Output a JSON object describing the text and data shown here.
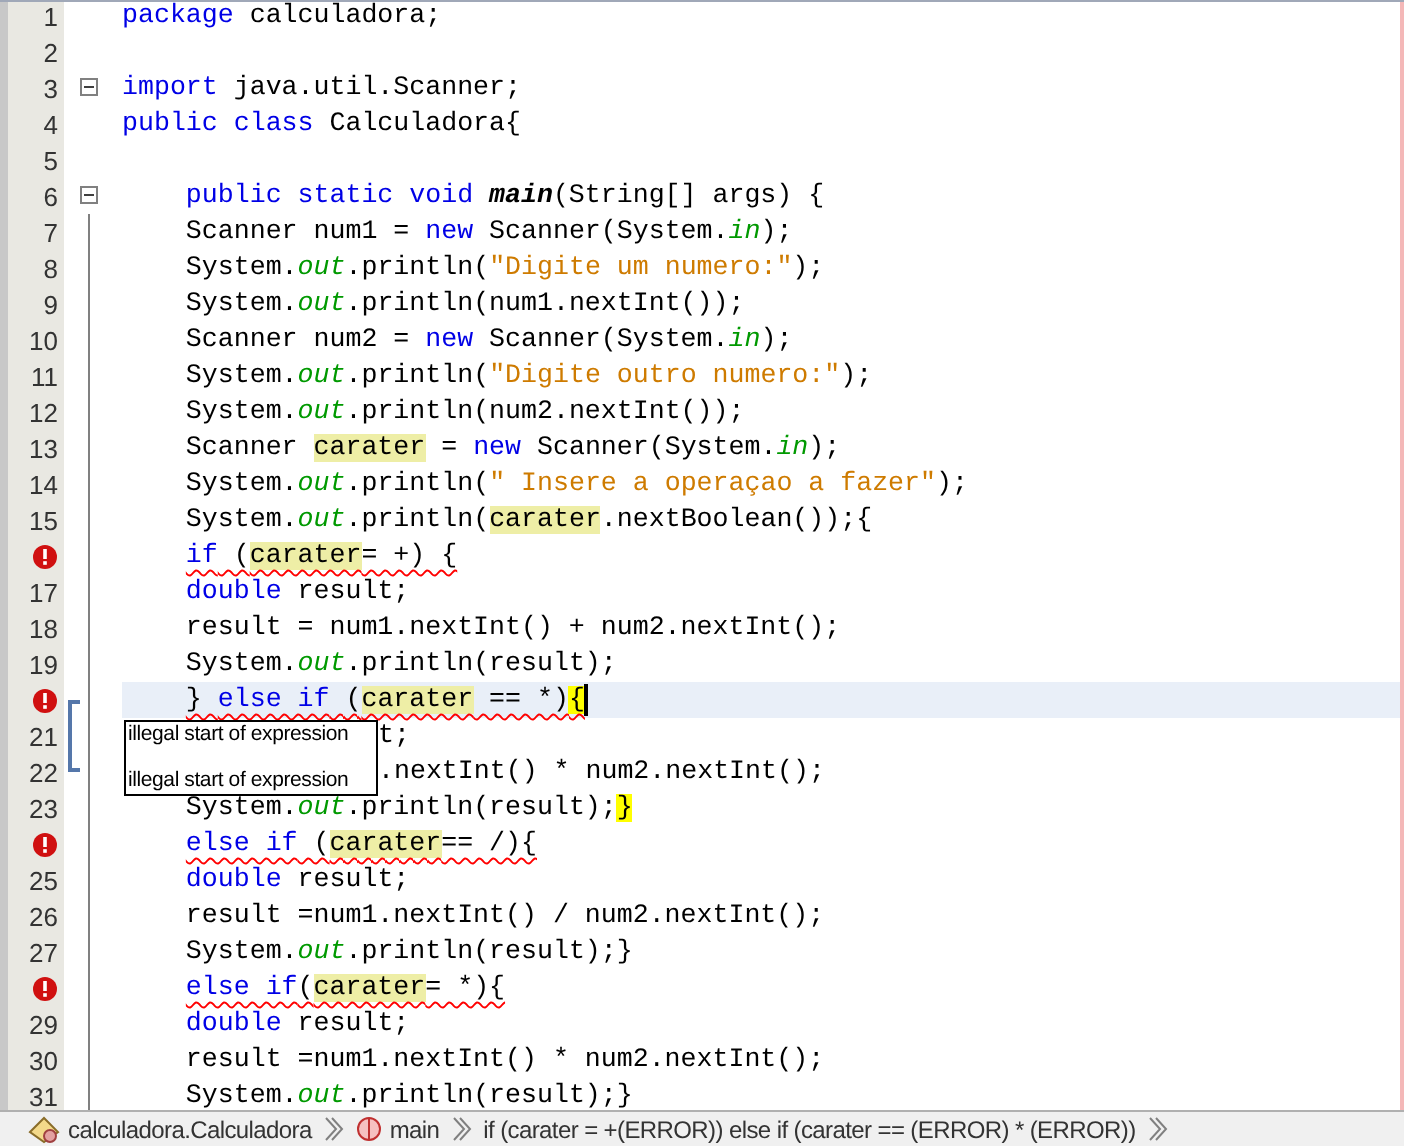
{
  "editor": {
    "lines": [
      {
        "number": "1",
        "error": false,
        "current": false,
        "squiggle": false,
        "collapsible": false,
        "matched_block": false,
        "covered": false,
        "tokens": [
          {
            "t": "package",
            "kind": "kw"
          },
          {
            "t": " calculadora;",
            "kind": "plain"
          }
        ]
      },
      {
        "number": "2",
        "error": false,
        "current": false,
        "collapsible": false,
        "matched_block": false
      },
      {
        "number": "3",
        "error": false,
        "current": false,
        "squiggle": false,
        "collapsible": true,
        "matched_block": false,
        "covered": false,
        "tokens": [
          {
            "t": "import",
            "kind": "kw"
          },
          {
            "t": " java.util.Scanner;",
            "kind": "plain"
          }
        ]
      },
      {
        "number": "4",
        "error": false,
        "current": false,
        "squiggle": false,
        "collapsible": false,
        "matched_block": false,
        "covered": false,
        "tokens": [
          {
            "t": "public class",
            "kind": "kw"
          },
          {
            "t": " Calculadora{",
            "kind": "plain"
          }
        ]
      },
      {
        "number": "5",
        "error": false,
        "current": false,
        "collapsible": false,
        "matched_block": false
      },
      {
        "number": "6",
        "error": false,
        "current": false,
        "squiggle": false,
        "collapsible": true,
        "matched_block": false,
        "covered": false,
        "tokens": [
          {
            "t": "    public static void ",
            "kind": "kw"
          },
          {
            "t": "main",
            "kind": "bold"
          },
          {
            "t": "(String[] args) {",
            "kind": "plain"
          }
        ]
      },
      {
        "number": "7",
        "error": false,
        "current": false,
        "squiggle": false,
        "collapsible": false,
        "matched_block": false,
        "covered": false,
        "tokens": [
          {
            "t": "    Scanner num1 = ",
            "kind": "plain"
          },
          {
            "t": "new",
            "kind": "kw"
          },
          {
            "t": " Scanner(System.",
            "kind": "plain"
          },
          {
            "t": "in",
            "kind": "field"
          },
          {
            "t": ");",
            "kind": "plain"
          }
        ]
      },
      {
        "number": "8",
        "error": false,
        "current": false,
        "squiggle": false,
        "collapsible": false,
        "matched_block": false,
        "covered": false,
        "tokens": [
          {
            "t": "    System.",
            "kind": "plain"
          },
          {
            "t": "out",
            "kind": "field"
          },
          {
            "t": ".println(",
            "kind": "plain"
          },
          {
            "t": "\"Digite um numero:\"",
            "kind": "str"
          },
          {
            "t": ");",
            "kind": "plain"
          }
        ]
      },
      {
        "number": "9",
        "error": false,
        "current": false,
        "squiggle": false,
        "collapsible": false,
        "matched_block": false,
        "covered": false,
        "tokens": [
          {
            "t": "    System.",
            "kind": "plain"
          },
          {
            "t": "out",
            "kind": "field"
          },
          {
            "t": ".println(num1.nextInt());",
            "kind": "plain"
          }
        ]
      },
      {
        "number": "10",
        "error": false,
        "current": false,
        "squiggle": false,
        "collapsible": false,
        "matched_block": false,
        "covered": false,
        "tokens": [
          {
            "t": "    Scanner num2 = ",
            "kind": "plain"
          },
          {
            "t": "new",
            "kind": "kw"
          },
          {
            "t": " Scanner(System.",
            "kind": "plain"
          },
          {
            "t": "in",
            "kind": "field"
          },
          {
            "t": ");",
            "kind": "plain"
          }
        ]
      },
      {
        "number": "11",
        "error": false,
        "current": false,
        "squiggle": false,
        "collapsible": false,
        "matched_block": false,
        "covered": false,
        "tokens": [
          {
            "t": "    System.",
            "kind": "plain"
          },
          {
            "t": "out",
            "kind": "field"
          },
          {
            "t": ".println(",
            "kind": "plain"
          },
          {
            "t": "\"Digite outro numero:\"",
            "kind": "str"
          },
          {
            "t": ");",
            "kind": "plain"
          }
        ]
      },
      {
        "number": "12",
        "error": false,
        "current": false,
        "squiggle": false,
        "collapsible": false,
        "matched_block": false,
        "covered": false,
        "tokens": [
          {
            "t": "    System.",
            "kind": "plain"
          },
          {
            "t": "out",
            "kind": "field"
          },
          {
            "t": ".println(num2.nextInt());",
            "kind": "plain"
          }
        ]
      },
      {
        "number": "13",
        "error": false,
        "current": false,
        "squiggle": false,
        "collapsible": false,
        "matched_block": false,
        "covered": false,
        "tokens": [
          {
            "t": "    Scanner ",
            "kind": "plain"
          },
          {
            "t": "carater",
            "kind": "occ"
          },
          {
            "t": " = ",
            "kind": "plain"
          },
          {
            "t": "new",
            "kind": "kw"
          },
          {
            "t": " Scanner(System.",
            "kind": "plain"
          },
          {
            "t": "in",
            "kind": "field"
          },
          {
            "t": ");",
            "kind": "plain"
          }
        ]
      },
      {
        "number": "14",
        "error": false,
        "current": false,
        "squiggle": false,
        "collapsible": false,
        "matched_block": false,
        "covered": false,
        "tokens": [
          {
            "t": "    System.",
            "kind": "plain"
          },
          {
            "t": "out",
            "kind": "field"
          },
          {
            "t": ".println(",
            "kind": "plain"
          },
          {
            "t": "\" Insere a operaçao a fazer\"",
            "kind": "str"
          },
          {
            "t": ");",
            "kind": "plain"
          }
        ]
      },
      {
        "number": "15",
        "error": false,
        "current": false,
        "squiggle": false,
        "collapsible": false,
        "matched_block": false,
        "covered": false,
        "tokens": [
          {
            "t": "    System.",
            "kind": "plain"
          },
          {
            "t": "out",
            "kind": "field"
          },
          {
            "t": ".println(",
            "kind": "plain"
          },
          {
            "t": "carater",
            "kind": "occ"
          },
          {
            "t": ".nextBoolean());{",
            "kind": "plain"
          }
        ]
      },
      {
        "error": true,
        "current": false,
        "squiggle": true,
        "collapsible": false,
        "matched_block": false,
        "covered": false,
        "tokens": [
          {
            "t": "    if",
            "kind": "kw"
          },
          {
            "t": " (",
            "kind": "plain"
          },
          {
            "t": "carater",
            "kind": "occ"
          },
          {
            "t": "= +) {",
            "kind": "plain"
          }
        ]
      },
      {
        "number": "17",
        "error": false,
        "current": false,
        "squiggle": false,
        "collapsible": false,
        "matched_block": false,
        "covered": false,
        "tokens": [
          {
            "t": "    double",
            "kind": "kw"
          },
          {
            "t": " result;",
            "kind": "plain"
          }
        ]
      },
      {
        "number": "18",
        "error": false,
        "current": false,
        "squiggle": false,
        "collapsible": false,
        "matched_block": false,
        "covered": false,
        "tokens": [
          {
            "t": "    result = num1.nextInt() + num2.nextInt();",
            "kind": "plain"
          }
        ]
      },
      {
        "number": "19",
        "error": false,
        "current": false,
        "squiggle": false,
        "collapsible": false,
        "matched_block": false,
        "covered": false,
        "tokens": [
          {
            "t": "    System.",
            "kind": "plain"
          },
          {
            "t": "out",
            "kind": "field"
          },
          {
            "t": ".println(result);",
            "kind": "plain"
          }
        ]
      },
      {
        "error": true,
        "current": true,
        "squiggle": true,
        "collapsible": false,
        "matched_block": true,
        "covered": false,
        "tokens": [
          {
            "t": "    } ",
            "kind": "plain"
          },
          {
            "t": "else if",
            "kind": "kw"
          },
          {
            "t": " (",
            "kind": "plain"
          },
          {
            "t": "carater",
            "kind": "occ"
          },
          {
            "t": " == *)",
            "kind": "plain"
          },
          {
            "t": "{",
            "kind": "brace"
          }
        ]
      },
      {
        "number": "21",
        "error": false,
        "current": false,
        "squiggle": false,
        "collapsible": false,
        "matched_block": true,
        "covered": true,
        "tooltip": [
          "illegal start of expression",
          "illegal start of expression"
        ],
        "tokens": [
          {
            "t": "t;",
            "kind": "plain"
          }
        ]
      },
      {
        "number": "22",
        "error": false,
        "current": false,
        "squiggle": false,
        "collapsible": false,
        "matched_block": true,
        "covered": true,
        "tokens": [
          {
            "t": ".nextInt() * num2.nextInt();",
            "kind": "plain"
          }
        ]
      },
      {
        "number": "23",
        "error": false,
        "current": false,
        "squiggle": false,
        "collapsible": false,
        "matched_block": false,
        "covered": false,
        "tokens": [
          {
            "t": "    System.",
            "kind": "plain"
          },
          {
            "t": "out",
            "kind": "field"
          },
          {
            "t": ".println(result);",
            "kind": "plain"
          },
          {
            "t": "}",
            "kind": "brace"
          }
        ]
      },
      {
        "error": true,
        "current": false,
        "squiggle": true,
        "collapsible": false,
        "matched_block": false,
        "covered": false,
        "tokens": [
          {
            "t": "    else if",
            "kind": "kw"
          },
          {
            "t": " (",
            "kind": "plain"
          },
          {
            "t": "carater",
            "kind": "occ"
          },
          {
            "t": "== /){",
            "kind": "plain"
          }
        ]
      },
      {
        "number": "25",
        "error": false,
        "current": false,
        "squiggle": false,
        "collapsible": false,
        "matched_block": false,
        "covered": false,
        "tokens": [
          {
            "t": "    double",
            "kind": "kw"
          },
          {
            "t": " result;",
            "kind": "plain"
          }
        ]
      },
      {
        "number": "26",
        "error": false,
        "current": false,
        "squiggle": false,
        "collapsible": false,
        "matched_block": false,
        "covered": false,
        "tokens": [
          {
            "t": "    result =num1.nextInt() / num2.nextInt();",
            "kind": "plain"
          }
        ]
      },
      {
        "number": "27",
        "error": false,
        "current": false,
        "squiggle": false,
        "collapsible": false,
        "matched_block": false,
        "covered": false,
        "tokens": [
          {
            "t": "    System.",
            "kind": "plain"
          },
          {
            "t": "out",
            "kind": "field"
          },
          {
            "t": ".println(result);}",
            "kind": "plain"
          }
        ]
      },
      {
        "error": true,
        "current": false,
        "squiggle": true,
        "collapsible": false,
        "matched_block": false,
        "covered": false,
        "tokens": [
          {
            "t": "    else if",
            "kind": "kw"
          },
          {
            "t": "(",
            "kind": "plain"
          },
          {
            "t": "carater",
            "kind": "occ"
          },
          {
            "t": "= *){",
            "kind": "plain"
          }
        ]
      },
      {
        "number": "29",
        "error": false,
        "current": false,
        "squiggle": false,
        "collapsible": false,
        "matched_block": false,
        "covered": false,
        "tokens": [
          {
            "t": "    double",
            "kind": "kw"
          },
          {
            "t": " result;",
            "kind": "plain"
          }
        ]
      },
      {
        "number": "30",
        "error": false,
        "current": false,
        "squiggle": false,
        "collapsible": false,
        "matched_block": false,
        "covered": false,
        "tokens": [
          {
            "t": "    result =num1.nextInt() * num2.nextInt();",
            "kind": "plain"
          }
        ]
      },
      {
        "number": "31",
        "error": false,
        "current": false,
        "squiggle": false,
        "collapsible": false,
        "matched_block": false,
        "covered": false,
        "tokens": [
          {
            "t": "    System.",
            "kind": "plain"
          },
          {
            "t": "out",
            "kind": "field"
          },
          {
            "t": ".println(result);}",
            "kind": "plain"
          }
        ]
      }
    ]
  },
  "breadcrumbs": [
    {
      "kind": "class",
      "label": "calculadora.Calculadora"
    },
    {
      "kind": "method",
      "label": "main"
    },
    {
      "kind": "statement",
      "label": "if (carater = +(ERROR)) else if (carater == (ERROR) * (ERROR))"
    }
  ]
}
